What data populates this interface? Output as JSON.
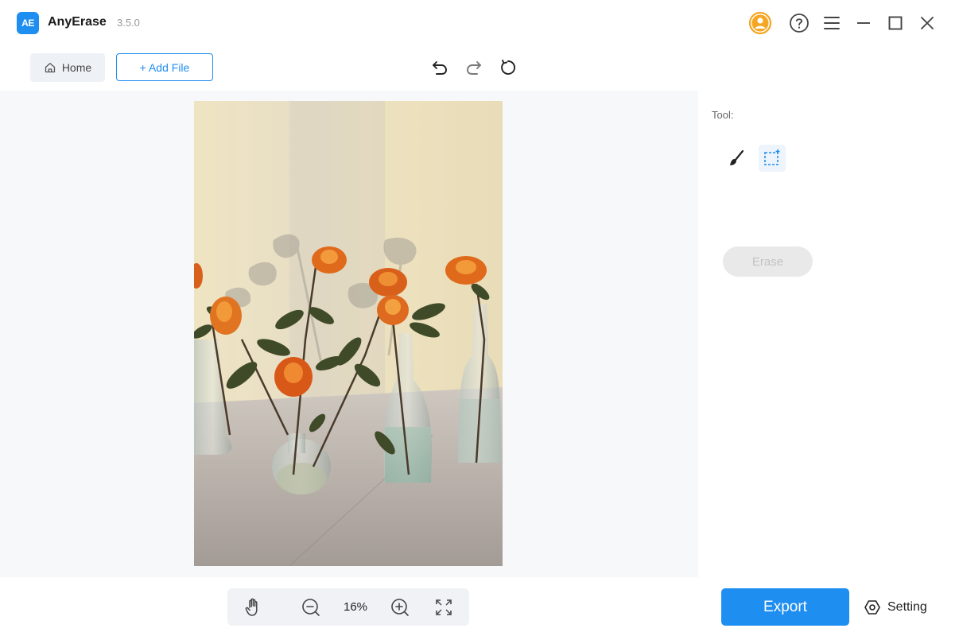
{
  "app": {
    "logo_text": "AE",
    "name": "AnyErase",
    "version": "3.5.0"
  },
  "window_controls": [
    "account-icon",
    "help-icon",
    "menu-icon",
    "minimize-icon",
    "maximize-icon",
    "close-icon"
  ],
  "toolbar": {
    "home_label": "Home",
    "add_file_label": "+ Add File",
    "history_icons": [
      "undo-icon",
      "redo-icon",
      "reset-icon"
    ]
  },
  "right_panel": {
    "tool_label": "Tool:",
    "tools": [
      "brush-icon",
      "rect-select-icon"
    ],
    "erase_label": "Erase"
  },
  "zoombar": {
    "zoom_value": "16%",
    "icons": [
      "hand-icon",
      "zoom-out-icon",
      "zoom-in-icon",
      "fit-screen-icon"
    ]
  },
  "footer": {
    "export_label": "Export",
    "setting_label": "Setting"
  },
  "colors": {
    "accent": "#1f8ef1",
    "account": "#f5a623",
    "canvas_bg": "#f7f8fa"
  }
}
